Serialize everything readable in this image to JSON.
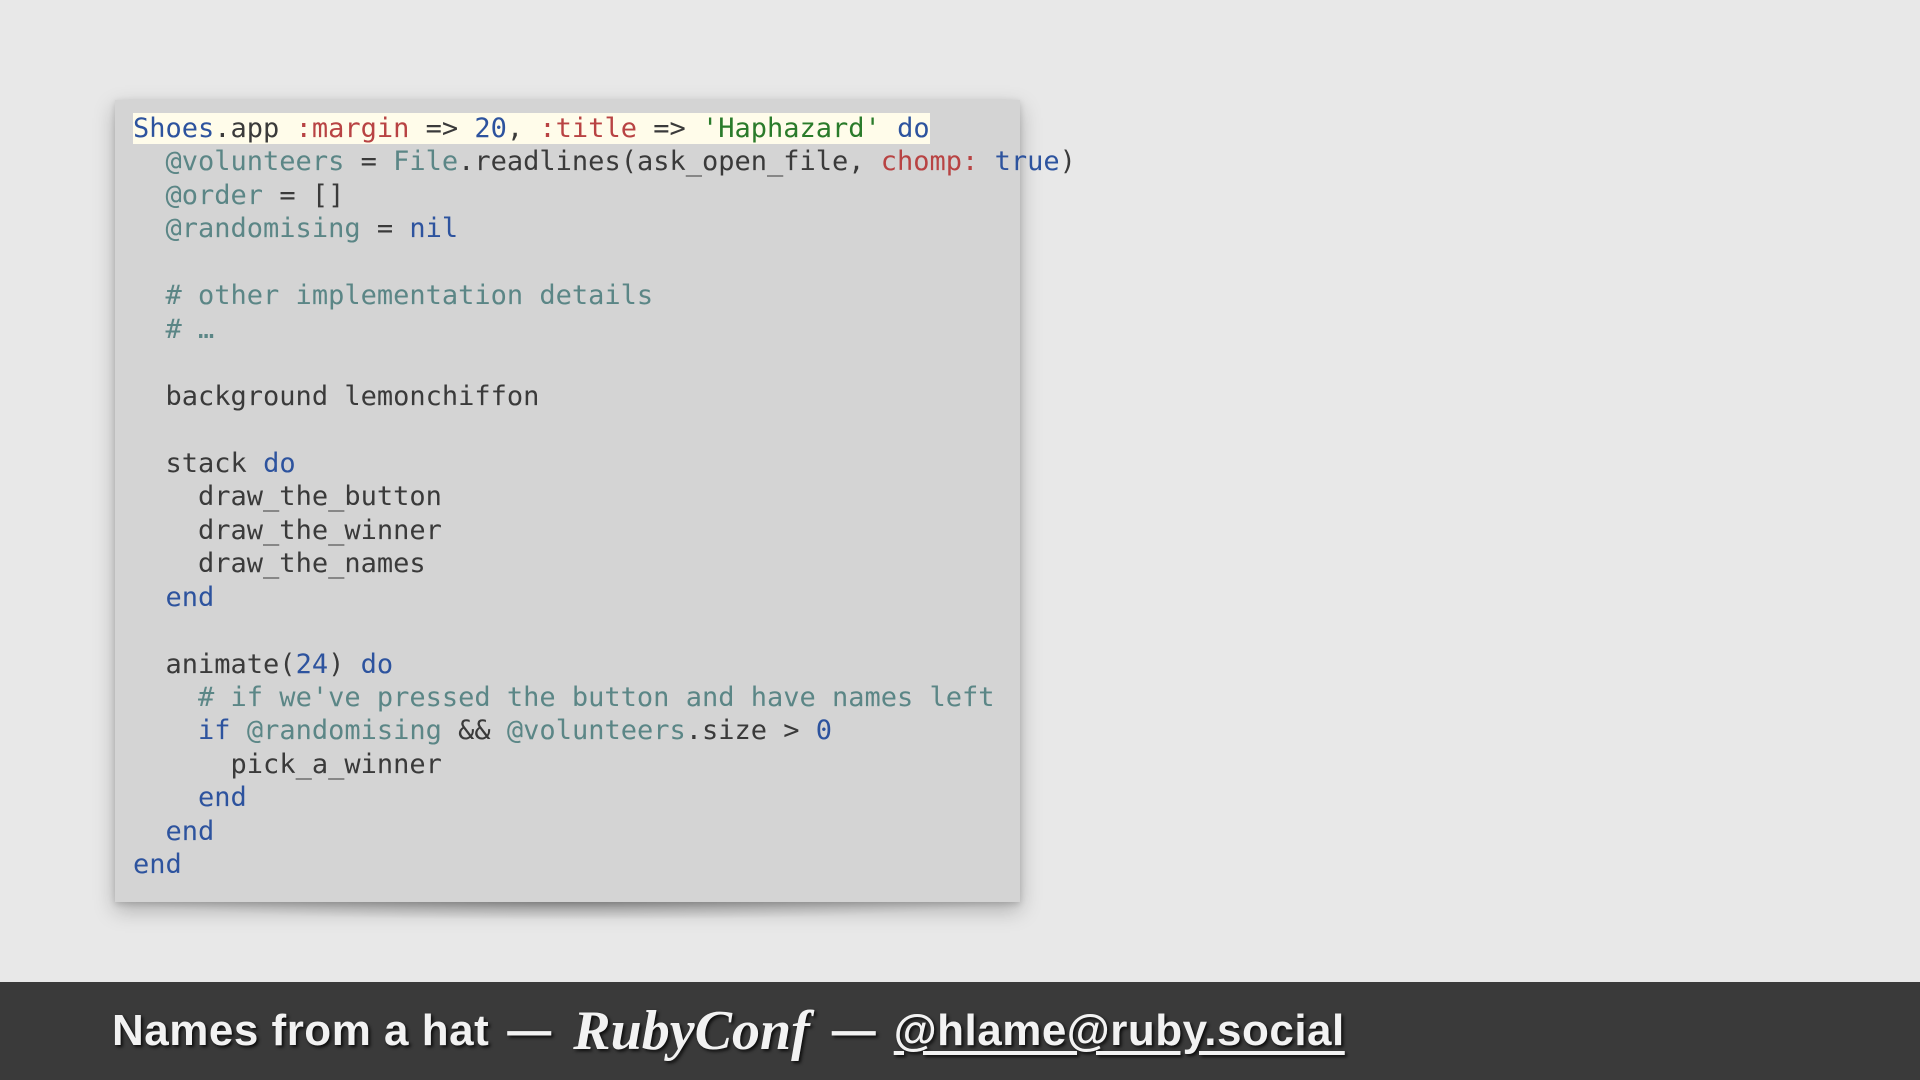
{
  "code": {
    "l1": {
      "a": "Shoes",
      "b": ".app ",
      "c": ":margin",
      "d": " => ",
      "e": "20",
      "f": ", ",
      "g": ":title",
      "h": " => ",
      "i": "'Haphazard'",
      "j": " ",
      "k": "do"
    },
    "l2": {
      "indent": "  ",
      "a": "@volunteers",
      "b": " = ",
      "c": "File",
      "d": ".readlines(ask_open_file, ",
      "e": "chomp:",
      "f": " ",
      "g": "true",
      "h": ")"
    },
    "l3": {
      "indent": "  ",
      "a": "@order",
      "b": " = []"
    },
    "l4": {
      "indent": "  ",
      "a": "@randomising",
      "b": " = ",
      "c": "nil"
    },
    "l6": {
      "indent": "  ",
      "a": "# other implementation details"
    },
    "l7": {
      "indent": "  ",
      "a": "# …"
    },
    "l9": {
      "indent": "  ",
      "a": "background lemonchiffon"
    },
    "l11": {
      "indent": "  ",
      "a": "stack ",
      "b": "do"
    },
    "l12": {
      "indent": "    ",
      "a": "draw_the_button"
    },
    "l13": {
      "indent": "    ",
      "a": "draw_the_winner"
    },
    "l14": {
      "indent": "    ",
      "a": "draw_the_names"
    },
    "l15": {
      "indent": "  ",
      "a": "end"
    },
    "l17": {
      "indent": "  ",
      "a": "animate(",
      "b": "24",
      "c": ") ",
      "d": "do"
    },
    "l18": {
      "indent": "    ",
      "a": "# if we've pressed the button and have names left"
    },
    "l19": {
      "indent": "    ",
      "a": "if",
      "b": " ",
      "c": "@randomising",
      "d": " && ",
      "e": "@volunteers",
      "f": ".size > ",
      "g": "0"
    },
    "l20": {
      "indent": "      ",
      "a": "pick_a_winner"
    },
    "l21": {
      "indent": "    ",
      "a": "end"
    },
    "l22": {
      "indent": "  ",
      "a": "end"
    },
    "l23": {
      "a": "end"
    }
  },
  "footer": {
    "title": "Names from a hat",
    "dash": "—",
    "conference": "RubyConf",
    "handle": "@hlame@ruby.social"
  }
}
